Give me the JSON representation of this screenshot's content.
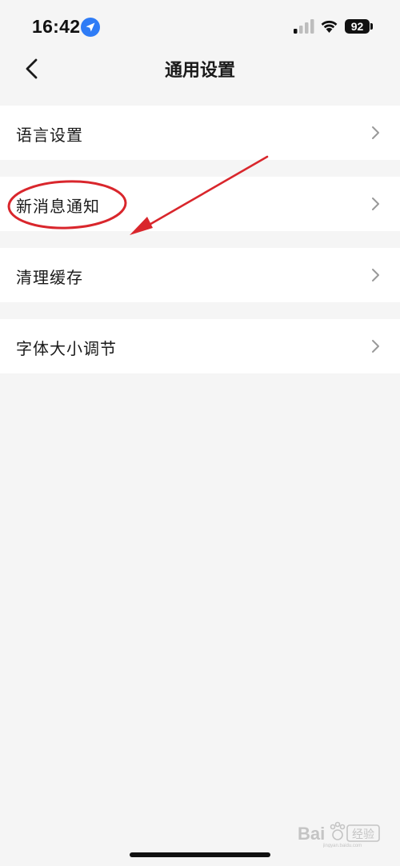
{
  "status_bar": {
    "time": "16:42",
    "battery": "92"
  },
  "nav": {
    "title": "通用设置",
    "back_icon": "chevron-left-icon"
  },
  "settings": [
    {
      "label": "语言设置",
      "icon": "chevron-right-icon"
    },
    {
      "label": "新消息通知",
      "icon": "chevron-right-icon"
    },
    {
      "label": "清理缓存",
      "icon": "chevron-right-icon"
    },
    {
      "label": "字体大小调节",
      "icon": "chevron-right-icon"
    }
  ],
  "annotation": {
    "color": "#d9262c"
  },
  "colors": {
    "background": "#f5f5f5",
    "row_background": "#ffffff",
    "chevron": "#999999",
    "location_badge": "#2f7cf6"
  }
}
